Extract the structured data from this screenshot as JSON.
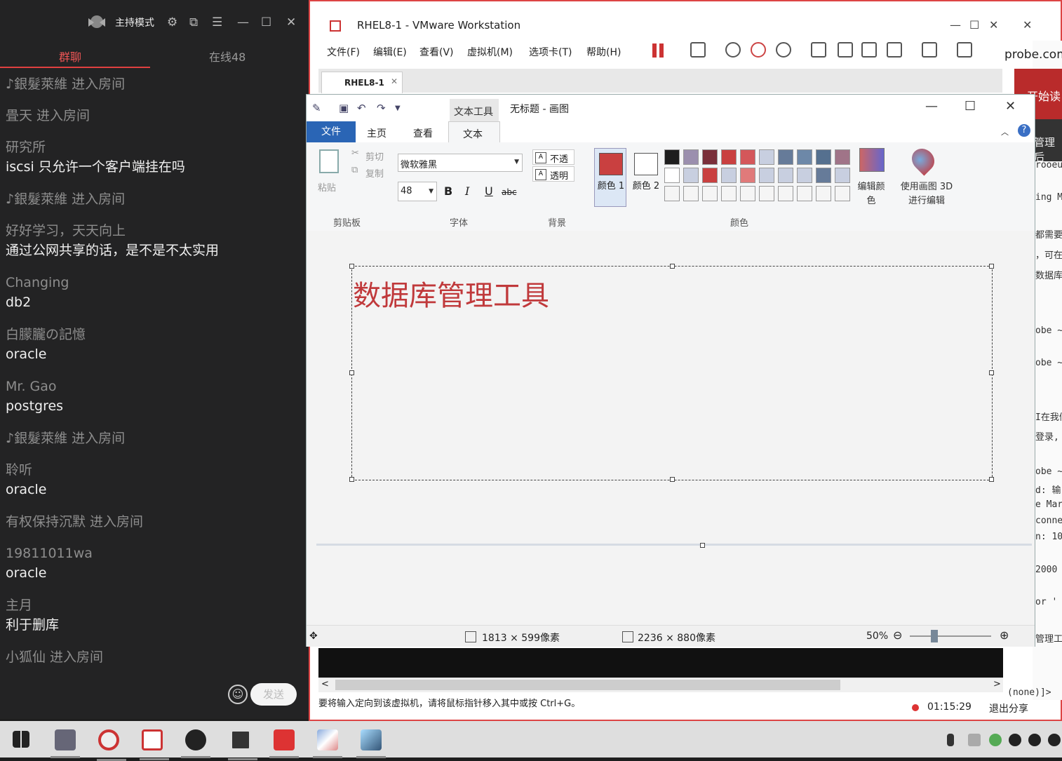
{
  "chat": {
    "mode_label": "主持模式",
    "tabs": {
      "group": "群聊",
      "online": "在线48"
    },
    "messages": [
      {
        "system": "♪銀髮萊維 进入房间"
      },
      {
        "system": "畳天 进入房间"
      },
      {
        "name": "研究所",
        "text": "iscsi 只允许一个客户端挂在吗"
      },
      {
        "system": "♪銀髮萊維 进入房间"
      },
      {
        "name": "好好学习，天天向上",
        "text": "通过公网共享的话，是不是不太实用"
      },
      {
        "name": "Changing",
        "text": "db2"
      },
      {
        "name": "白朦朧の記憶",
        "text": "oracle"
      },
      {
        "name": "Mr. Gao",
        "text": "postgres"
      },
      {
        "system": "♪銀髮萊維 进入房间"
      },
      {
        "name": "聆听",
        "text": "oracle"
      },
      {
        "system": "有权保持沉默 进入房间"
      },
      {
        "name": "19811011wa",
        "text": "oracle"
      },
      {
        "name": "主月",
        "text": "利于删库"
      },
      {
        "system": "小狐仙 进入房间"
      }
    ],
    "send_label": "发送"
  },
  "vmware": {
    "title": "RHEL8-1 - VMware Workstation",
    "menus": [
      "文件(F)",
      "编辑(E)",
      "查看(V)",
      "虚拟机(M)",
      "选项卡(T)",
      "帮助(H)"
    ],
    "tab_label": "RHEL8-1",
    "status_text": "要将输入定向到该虚拟机，请将鼠标指针移入其中或按 Ctrl+G。",
    "timer": "01:15:29",
    "exit_share": "退出分享",
    "side_probe": "probe.com",
    "side_button": "开始读",
    "side_dark": "管理后",
    "side_lines": [
      "rooeu",
      "ing M",
      "都需要",
      "，可在",
      "数据库",
      "obe ~",
      "obe ~",
      "I在我们",
      "登录,",
      "obe ~",
      "d: 输",
      "e Mar",
      "conne",
      "n: 10",
      "2000",
      "or '",
      "管理工",
      "(none)]>"
    ]
  },
  "paint": {
    "context_tab": "文本工具",
    "doc_title": "无标题 - 画图",
    "ribbon_tabs": {
      "file": "文件",
      "home": "主页",
      "view": "查看",
      "text": "文本"
    },
    "clipboard": {
      "paste": "粘贴",
      "cut": "剪切",
      "copy": "复制",
      "group": "剪贴板"
    },
    "font": {
      "family": "微软雅黑",
      "size": "48",
      "group": "字体",
      "bold": "B",
      "italic": "I",
      "underline": "U",
      "strike": "abc"
    },
    "background": {
      "opaque": "不透明",
      "transparent": "透明",
      "group": "背景"
    },
    "colors": {
      "color1_label": "颜色 1",
      "color2_label": "颜色 2",
      "color1": "#c94040",
      "color2": "#ffffff",
      "edit_colors": "编辑颜色",
      "paint3d": "使用画图 3D 进行编辑",
      "group": "颜色",
      "palette_row1": [
        "#1e1e1e",
        "#9b8fae",
        "#7a2f3a",
        "#c94040",
        "#d4575a",
        "#c8cfe0",
        "#667b99",
        "#6d88a8",
        "#55708f",
        "#a07488"
      ],
      "palette_row2": [
        "#ffffff",
        "#c8cfe0",
        "#c94040",
        "#c8cfe0",
        "#e07a7a",
        "#c8cfe0",
        "#c8cfe0",
        "#c8cfe0",
        "#667b99",
        "#c8cfe0"
      ],
      "palette_row3": [
        "#f5f5f5",
        "#f5f5f5",
        "#f5f5f5",
        "#f5f5f5",
        "#f5f5f5",
        "#f5f5f5",
        "#f5f5f5",
        "#f5f5f5",
        "#f5f5f5",
        "#f5f5f5"
      ]
    },
    "canvas_text": "数据库管理工具",
    "status": {
      "selection": "1813 × 599像素",
      "image": "2236 × 880像素",
      "zoom": "50%"
    }
  }
}
